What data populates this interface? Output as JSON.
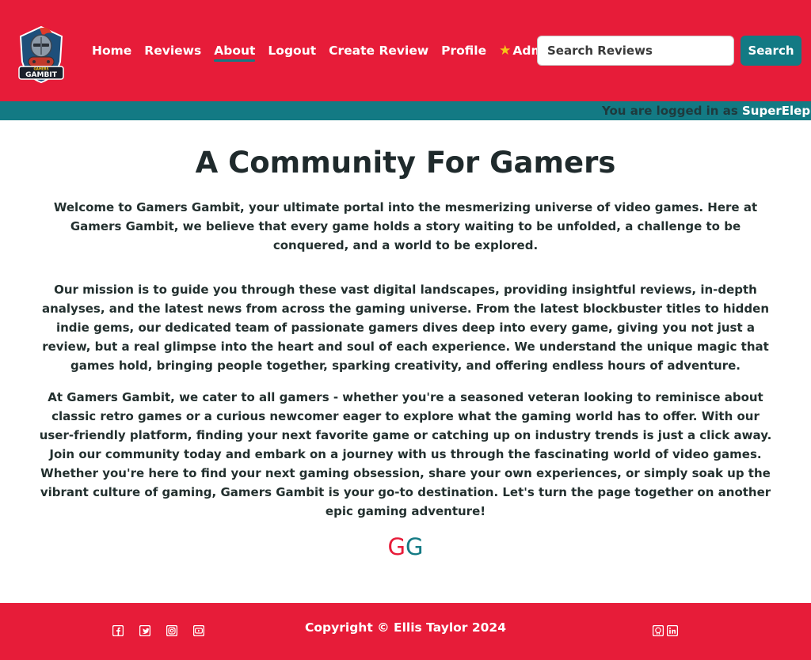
{
  "brand": {
    "logo_text": "GAMBIT",
    "logo_small": "GAMERS"
  },
  "nav": {
    "items": [
      {
        "label": "Home"
      },
      {
        "label": "Reviews"
      },
      {
        "label": "About"
      },
      {
        "label": "Logout"
      },
      {
        "label": "Create Review"
      },
      {
        "label": "Profile"
      },
      {
        "label": "Admin",
        "icon": "star-icon"
      }
    ],
    "active": "About"
  },
  "search": {
    "placeholder": "Search Reviews",
    "value": "",
    "button_label": "Search"
  },
  "login_status": {
    "prefix": "You are logged in as",
    "username": "SuperElephant"
  },
  "main": {
    "title": "A Community For Gamers",
    "paragraphs": [
      "Welcome to Gamers Gambit, your ultimate portal into the mesmerizing universe of video games. Here at Gamers Gambit, we believe that every game holds a story waiting to be unfolded, a challenge to be conquered, and a world to be explored.",
      "Our mission is to guide you through these vast digital landscapes, providing insightful reviews, in-depth analyses, and the latest news from across the gaming universe. From the latest blockbuster titles to hidden indie gems, our dedicated team of passionate gamers dives deep into every game, giving you not just a review, but a real glimpse into the heart and soul of each experience. We understand the unique magic that games hold, bringing people together, sparking creativity, and offering endless hours of adventure.",
      "At Gamers Gambit, we cater to all gamers - whether you're a seasoned veteran looking to reminisce about classic retro games or a curious newcomer eager to explore what the gaming world has to offer. With our user-friendly platform, finding your next favorite game or catching up on industry trends is just a click away. Join our community today and embark on a journey with us through the fascinating world of video games. Whether you're here to find your next gaming obsession, share your own experiences, or simply soak up the vibrant culture of gaming, Gamers Gambit is your go-to destination. Let's turn the page together on another epic gaming adventure!"
    ],
    "mark_first": "G",
    "mark_second": "G"
  },
  "footer": {
    "copyright": "Copyright © Ellis Taylor 2024",
    "social_icons": [
      "facebook-icon",
      "twitter-icon",
      "instagram-icon",
      "youtube-icon"
    ],
    "dev_icons": [
      "github-icon",
      "linkedin-icon"
    ]
  },
  "colors": {
    "primary": "#e71c39",
    "accent": "#137a84",
    "text": "#1f2a2c",
    "star": "#f5c518"
  }
}
